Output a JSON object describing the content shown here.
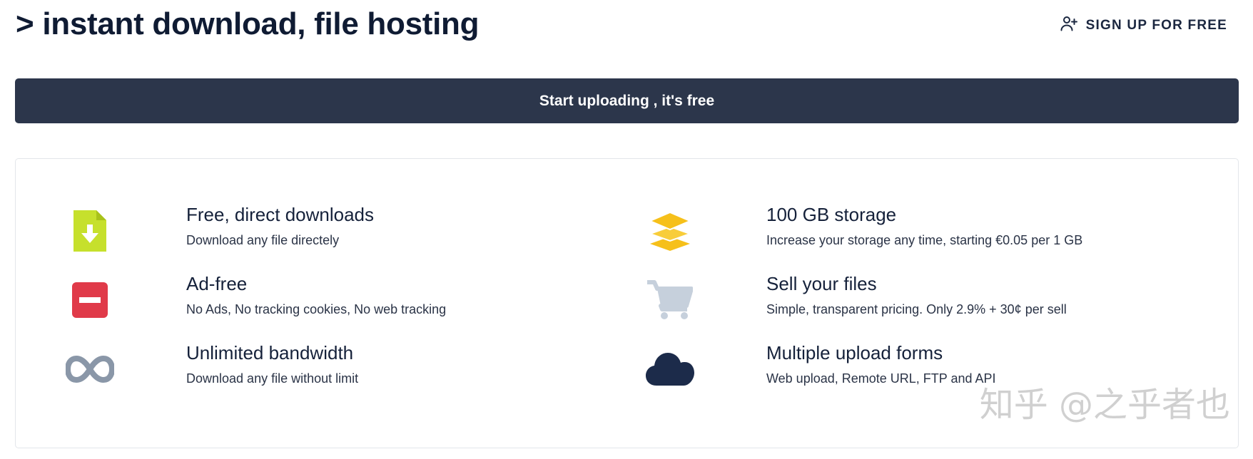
{
  "header": {
    "title": "> instant download, file hosting",
    "signup_label": "SIGN UP FOR FREE",
    "signup_icon": "user-plus-icon"
  },
  "upload_button": {
    "label": "Start uploading , it's free"
  },
  "features": [
    {
      "title": "Free, direct downloads",
      "description": "Download any file directely",
      "icon": "file-download-icon",
      "icon_color": "#c6e02c"
    },
    {
      "title": "100 GB storage",
      "description": "Increase your storage any time, starting €0.05 per 1 GB",
      "icon": "layers-icon",
      "icon_color": "#f6c01a"
    },
    {
      "title": "Ad-free",
      "description": "No Ads, No tracking cookies, No web tracking",
      "icon": "minus-square-icon",
      "icon_color": "#e03a49"
    },
    {
      "title": "Sell your files",
      "description": "Simple, transparent pricing. Only 2.9% + 30¢ per sell",
      "icon": "shopping-cart-icon",
      "icon_color": "#c6d0dc"
    },
    {
      "title": "Unlimited bandwidth",
      "description": "Download any file without limit",
      "icon": "infinity-icon",
      "icon_color": "#8a97a8"
    },
    {
      "title": "Multiple upload forms",
      "description": "Web upload, Remote URL, FTP and API",
      "icon": "cloud-icon",
      "icon_color": "#1c2b4a"
    }
  ],
  "watermark": {
    "text": "知乎 @之乎者也"
  }
}
